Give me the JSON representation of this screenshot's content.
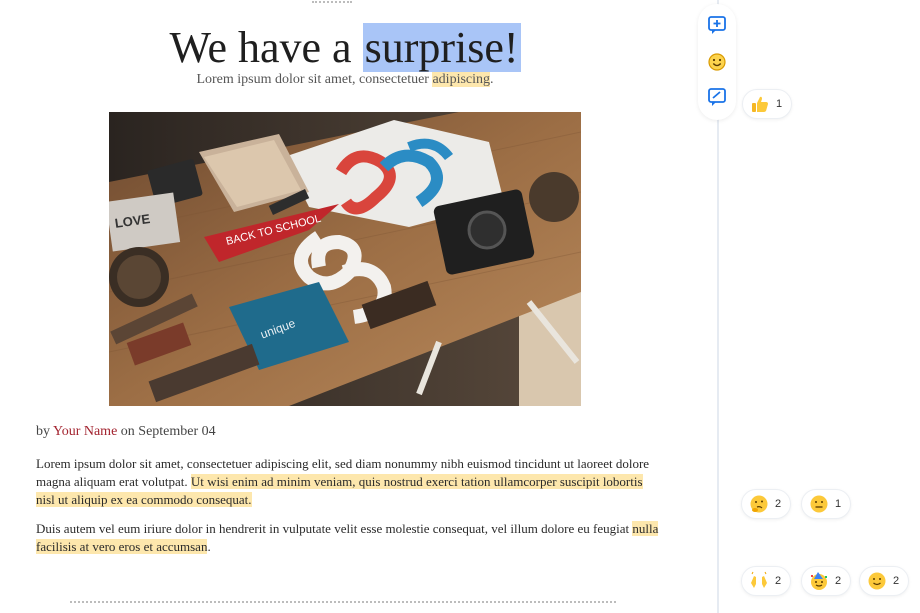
{
  "document": {
    "title_prefix": "We have a ",
    "title_selected": "surprise!",
    "subtitle_prefix": "Lorem ipsum dolor sit amet, consectetuer ",
    "subtitle_highlight": "adipiscing",
    "subtitle_suffix": ".",
    "byline_prefix": "by ",
    "author": "Your Name",
    "byline_middle": " on ",
    "date": "September 04",
    "p1_plain": "Lorem ipsum dolor sit amet, consectetuer adipiscing elit, sed diam nonummy nibh euismod tincidunt ut laoreet dolore magna aliquam erat volutpat. ",
    "p1_highlight": "Ut wisi enim ad minim veniam, quis nostrud exerci tation ullamcorper suscipit lobortis nisl ut aliquip ex ea commodo consequat.",
    "p2_plain": "Duis autem vel eum iriure dolor in hendrerit in vulputate velit esse molestie consequat, vel illum dolore eu feugiat ",
    "p2_highlight": "nulla facilisis at vero eros et accumsan",
    "p2_suffix": "."
  },
  "toolbar": {
    "icons": [
      "add-comment-icon",
      "emoji-reaction-icon",
      "suggest-edit-icon"
    ]
  },
  "reactions": [
    {
      "emoji": "thumbs-up-icon",
      "count": "1"
    },
    {
      "emoji": "thinking-face-icon",
      "count": "2"
    },
    {
      "emoji": "confused-face-icon",
      "count": "1"
    },
    {
      "emoji": "raised-hands-icon",
      "count": "2"
    },
    {
      "emoji": "party-face-icon",
      "count": "2"
    },
    {
      "emoji": "smiling-face-icon",
      "count": "2"
    }
  ],
  "colors": {
    "selection": "#a9c5f7",
    "highlight": "#fde7ad",
    "author_link": "#a3232f",
    "accent": "#1a73e8"
  }
}
